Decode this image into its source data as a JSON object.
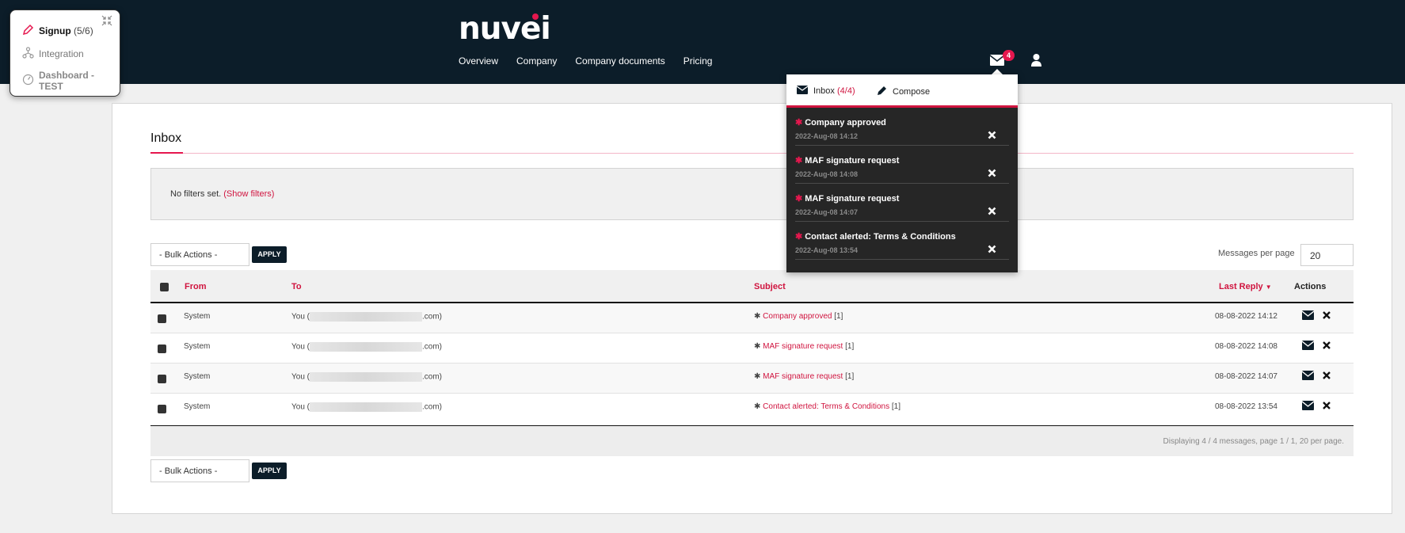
{
  "header": {
    "logo": "nuvei",
    "nav": [
      "Overview",
      "Company",
      "Company documents",
      "Pricing"
    ],
    "messages_badge": "4",
    "icons": [
      "envelope-icon",
      "user-icon"
    ]
  },
  "sidemenu": {
    "items": [
      {
        "label": "Signup",
        "suffix": "(5/6)",
        "icon": "pencil-icon"
      },
      {
        "label": "Integration",
        "icon": "nodes-icon"
      },
      {
        "label": "Dashboard - TEST",
        "icon": "gauge-icon"
      }
    ]
  },
  "dropdown": {
    "inbox_label": "Inbox",
    "inbox_count": "(4/4)",
    "compose_label": "Compose",
    "items": [
      {
        "title": "Company approved",
        "date": "2022-Aug-08 14:12"
      },
      {
        "title": "MAF signature request",
        "date": "2022-Aug-08 14:08"
      },
      {
        "title": "MAF signature request",
        "date": "2022-Aug-08 14:07"
      },
      {
        "title": "Contact alerted: Terms & Conditions",
        "date": "2022-Aug-08 13:54"
      }
    ]
  },
  "inbox": {
    "title": "Inbox",
    "filters_text": "No filters set.",
    "show_filters": "(Show filters)",
    "bulk_actions": "- Bulk Actions -",
    "apply": "APPLY",
    "messages_per_page_label": "Messages per page",
    "messages_per_page": "20",
    "columns": [
      "From",
      "To",
      "Subject",
      "Last Reply",
      "Actions"
    ],
    "rows": [
      {
        "from": "System",
        "to_prefix": "You (",
        "to_suffix": ".com)",
        "subject": "Company approved",
        "count": "[1]",
        "last_reply": "08-08-2022 14:12"
      },
      {
        "from": "System",
        "to_prefix": "You (",
        "to_suffix": ".com)",
        "subject": "MAF signature request",
        "count": "[1]",
        "last_reply": "08-08-2022 14:08"
      },
      {
        "from": "System",
        "to_prefix": "You (",
        "to_suffix": ".com)",
        "subject": "MAF signature request",
        "count": "[1]",
        "last_reply": "08-08-2022 14:07"
      },
      {
        "from": "System",
        "to_prefix": "You (",
        "to_suffix": ".com)",
        "subject": "Contact alerted: Terms & Conditions",
        "count": "[1]",
        "last_reply": "08-08-2022 13:54"
      }
    ],
    "footer": "Displaying 4 / 4 messages, page 1 / 1, 20 per page."
  },
  "colors": {
    "navy": "#0c1d29",
    "accent": "#e5174e",
    "link": "#d0143f"
  }
}
